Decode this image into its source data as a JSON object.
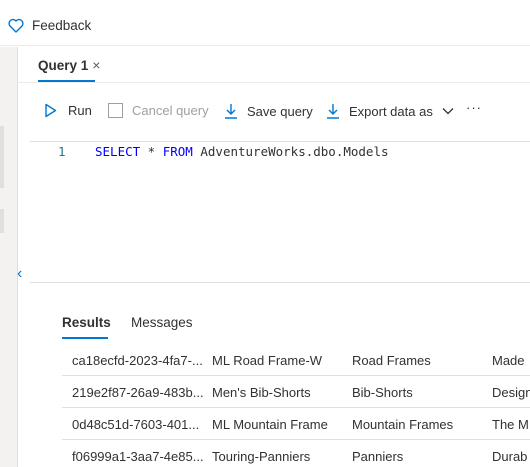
{
  "header": {
    "feedback_label": "Feedback"
  },
  "tabs": [
    {
      "label": "Query 1",
      "close": "×"
    }
  ],
  "toolbar": {
    "run_label": "Run",
    "cancel_label": "Cancel query",
    "save_label": "Save query",
    "export_label": "Export data as",
    "more_label": "···"
  },
  "editor": {
    "line_number": "1",
    "kw_select": "SELECT",
    "star": " * ",
    "kw_from": "FROM",
    "table": " AdventureWorks.dbo.Models"
  },
  "results": {
    "tabs": [
      "Results",
      "Messages"
    ],
    "rows": [
      [
        "ca18ecfd-2023-4fa7-...",
        "ML Road Frame-W",
        "Road Frames",
        "Made"
      ],
      [
        "219e2f87-26a9-483b...",
        "Men's Bib-Shorts",
        "Bib-Shorts",
        "Design"
      ],
      [
        "0d48c51d-7603-401...",
        "ML Mountain Frame",
        "Mountain Frames",
        "The M"
      ],
      [
        "f06999a1-3aa7-4e85...",
        "Touring-Panniers",
        "Panniers",
        "Durab"
      ]
    ]
  },
  "colors": {
    "accent": "#0078d4",
    "keyword": "#0000ff",
    "line_number": "#237893"
  },
  "icons": [
    "heart-icon",
    "play-icon",
    "checkbox-icon",
    "download-icon",
    "chevron-down-icon",
    "chevron-left-icon"
  ]
}
